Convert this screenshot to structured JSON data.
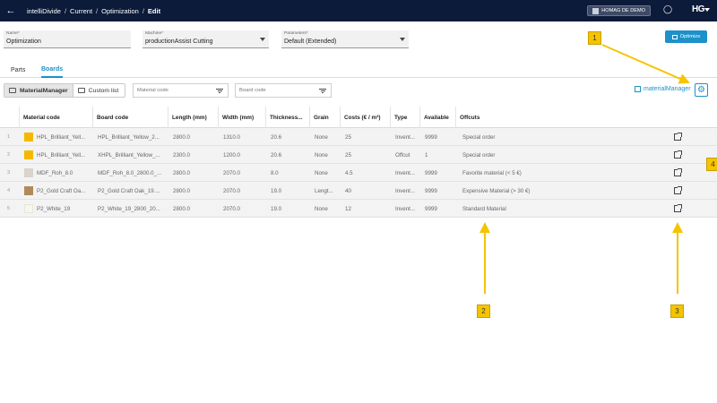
{
  "header": {
    "breadcrumbs": [
      "intelliDivide",
      "Current",
      "Optimization",
      "Edit"
    ],
    "company": "HOMAG DE DEMO",
    "logo": "HG"
  },
  "form": {
    "name": {
      "label": "Name*",
      "value": "Optimization"
    },
    "machine": {
      "label": "Machine*",
      "value": "productionAssist Cutting"
    },
    "parameters": {
      "label": "Parameters*",
      "value": "Default (Extended)"
    }
  },
  "optimize_label": "Optimize",
  "tabs": [
    {
      "label": "Parts",
      "active": false
    },
    {
      "label": "Boards",
      "active": true
    }
  ],
  "toolbar": {
    "material_manager": "MaterialManager",
    "custom_list": "Custom list",
    "material_code_placeholder": "Material code",
    "board_code_placeholder": "Board code",
    "materialmanager_link": "materialManager"
  },
  "table": {
    "columns": [
      "Material code",
      "Board code",
      "Length (mm)",
      "Width (mm)",
      "Thickness...",
      "Grain",
      "Costs (€ / m²)",
      "Type",
      "Available",
      "Offcuts"
    ],
    "rows": [
      {
        "n": "1",
        "swatch": "#f5b800",
        "material": "HPL_Brilliant_Yell...",
        "board": "HPL_Brilliant_Yellow_2...",
        "length": "2800.0",
        "width": "1310.0",
        "thickness": "20.6",
        "grain": "None",
        "costs": "25",
        "type": "Invent...",
        "available": "9999",
        "offcuts": "Special order"
      },
      {
        "n": "2",
        "swatch": "#f5b800",
        "material": "HPL_Brilliant_Yell...",
        "board": "XHPL_Brilliant_Yellow_...",
        "length": "2300.0",
        "width": "1200.0",
        "thickness": "20.6",
        "grain": "None",
        "costs": "25",
        "type": "Offcut",
        "available": "1",
        "offcuts": "Special order"
      },
      {
        "n": "3",
        "swatch": "#d9d4cc",
        "material": "MDF_Roh_8.0",
        "board": "MDF_Roh_8.0_2800.0_...",
        "length": "2800.0",
        "width": "2070.0",
        "thickness": "8.0",
        "grain": "None",
        "costs": "4.5",
        "type": "Invent...",
        "available": "9999",
        "offcuts": "Favorite material (< 5 €)"
      },
      {
        "n": "4",
        "swatch": "#b08a5a",
        "material": "P2_Gold Craft Oa...",
        "board": "P2_Gold Craft Oak_19....",
        "length": "2800.0",
        "width": "2070.0",
        "thickness": "19.0",
        "grain": "Lengt...",
        "costs": "40",
        "type": "Invent...",
        "available": "9999",
        "offcuts": "Expensive Material (> 30 €)"
      },
      {
        "n": "5",
        "swatch": "#f7f6ee",
        "material": "P2_White_19",
        "board": "P2_White_19_2800_20...",
        "length": "2800.0",
        "width": "2070.0",
        "thickness": "19.0",
        "grain": "None",
        "costs": "12",
        "type": "Invent...",
        "available": "9999",
        "offcuts": "Standard Material"
      }
    ]
  },
  "callouts": [
    "1",
    "2",
    "3",
    "4"
  ],
  "colors": {
    "header_bg": "#0d1b3a",
    "accent": "#1d91c9",
    "callout": "#f5c400"
  }
}
